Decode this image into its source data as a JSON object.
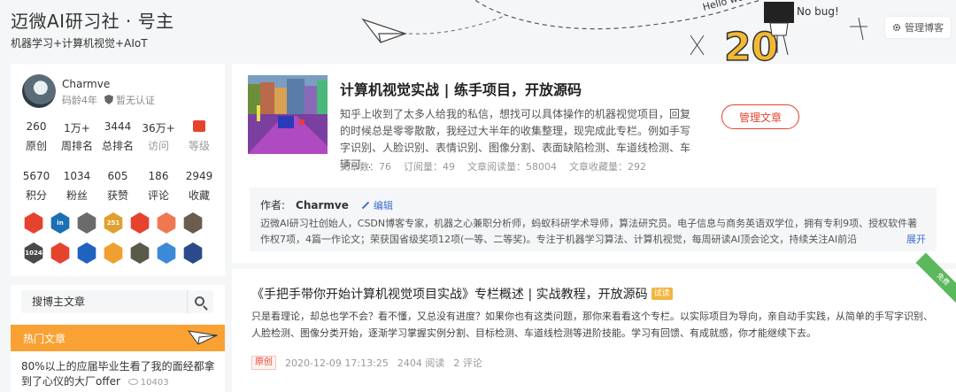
{
  "header": {
    "title": "迈微AI研习社 · 号主",
    "subtitle": "机器学习+计算机视觉+AIoT",
    "manage_blog": "管理博客",
    "deco_text_1": "Hello world!",
    "deco_text_2": "No bug!",
    "deco_number": "20"
  },
  "profile": {
    "name": "Charmve",
    "code_age": "码龄4年",
    "cert": "暂无认证",
    "stats_row1": [
      {
        "value": "260",
        "label": "原创"
      },
      {
        "value": "1万+",
        "label": "周排名"
      },
      {
        "value": "3444",
        "label": "总排名"
      },
      {
        "value": "36万+",
        "label": "访问"
      },
      {
        "value": "",
        "label": "等级"
      }
    ],
    "stats_row2": [
      {
        "value": "5670",
        "label": "积分"
      },
      {
        "value": "1034",
        "label": "粉丝"
      },
      {
        "value": "605",
        "label": "获赞"
      },
      {
        "value": "186",
        "label": "评论"
      },
      {
        "value": "2949",
        "label": "收藏"
      }
    ],
    "badges_row1": [
      {
        "name": "red-badge-icon",
        "color": "#e6432e",
        "text": ""
      },
      {
        "name": "linkedin-badge-icon",
        "color": "#1b6fb5",
        "text": "in"
      },
      {
        "name": "github-badge-icon",
        "color": "#6b6b6b",
        "text": ""
      },
      {
        "name": "rainbow-badge-icon",
        "color": "#e0a030",
        "text": "251"
      },
      {
        "name": "fire-badge-icon",
        "color": "#e6432e",
        "text": ""
      },
      {
        "name": "pink-badge-icon",
        "color": "#f07850",
        "text": ""
      },
      {
        "name": "gray-badge-icon",
        "color": "#6a5d4e",
        "text": ""
      }
    ],
    "badges_row2": [
      {
        "name": "1024-badge-icon",
        "color": "#4a4a4a",
        "text": "1024"
      },
      {
        "name": "pen-badge-icon",
        "color": "#e6432e",
        "text": ""
      },
      {
        "name": "flag-badge-icon",
        "color": "#1e63c0",
        "text": ""
      },
      {
        "name": "check-badge-icon",
        "color": "#f0a030",
        "text": ""
      },
      {
        "name": "dark-badge-icon",
        "color": "#5a5a4a",
        "text": ""
      },
      {
        "name": "blue-badge-icon",
        "color": "#3a8ad8",
        "text": ""
      },
      {
        "name": "navy-badge-icon",
        "color": "#2a4a8a",
        "text": ""
      }
    ]
  },
  "search": {
    "placeholder": "搜博主文章"
  },
  "hot": {
    "title": "热门文章",
    "item_text": "80%以上的应届毕业生看了我的面经都拿到了心仪的大厂offer",
    "item_views": "10403"
  },
  "column": {
    "title": "计算机视觉实战 | 练手项目，开放源码",
    "desc": "知乎上收到了太多人给我的私信，想找可以具体操作的机器视觉项目，回复的时候总是零零散散，我经过大半年的收集整理，现完成此专栏。例如手写字识别、人脸识别、表情识别、图像分割、表面缺陷检测、车道线检测、车辆可...",
    "stats": [
      "文章数：76",
      "订阅量：49",
      "文章阅读量：58004",
      "文章收藏量：292"
    ],
    "manage_button": "管理文章",
    "author_label": "作者:",
    "author_name": "Charmve",
    "edit_label": "编辑",
    "author_desc": "迈微AI研习社创始人，CSDN博客专家，机器之心兼职分析师，蚂蚁科研学术导师，算法研究员。电子信息与商务英语双学位，拥有专利9项、授权软件著作权7项，4篇一作论文；荣获国省级奖项12项(一等、二等奖)。专注于机器学习算法、计算机视觉，每周研读AI顶会论文，持续关注AI前沿",
    "expand_label": "展开"
  },
  "article": {
    "title": "《手把手带你开始计算机视觉项目实战》专栏概述 | 实战教程，开放源码",
    "trial_tag": "试读",
    "ribbon": "免费",
    "desc": "只是看理论，却总也学不会？看不懂，又总没有进度？如果你也有这类问题，那你来看看这个专栏。以实际项目为导向，亲自动手实践，从简单的手写字识别、人脸检测、图像分类开始，逐渐学习掌握实例分割、目标检测、车道线检测等进阶技能。学习有回馈、有成就感，你才能继续下去。",
    "original_tag": "原创",
    "date": "2020-12-09 17:13:25",
    "reads": "2404 阅读",
    "comments": "2 评论"
  }
}
